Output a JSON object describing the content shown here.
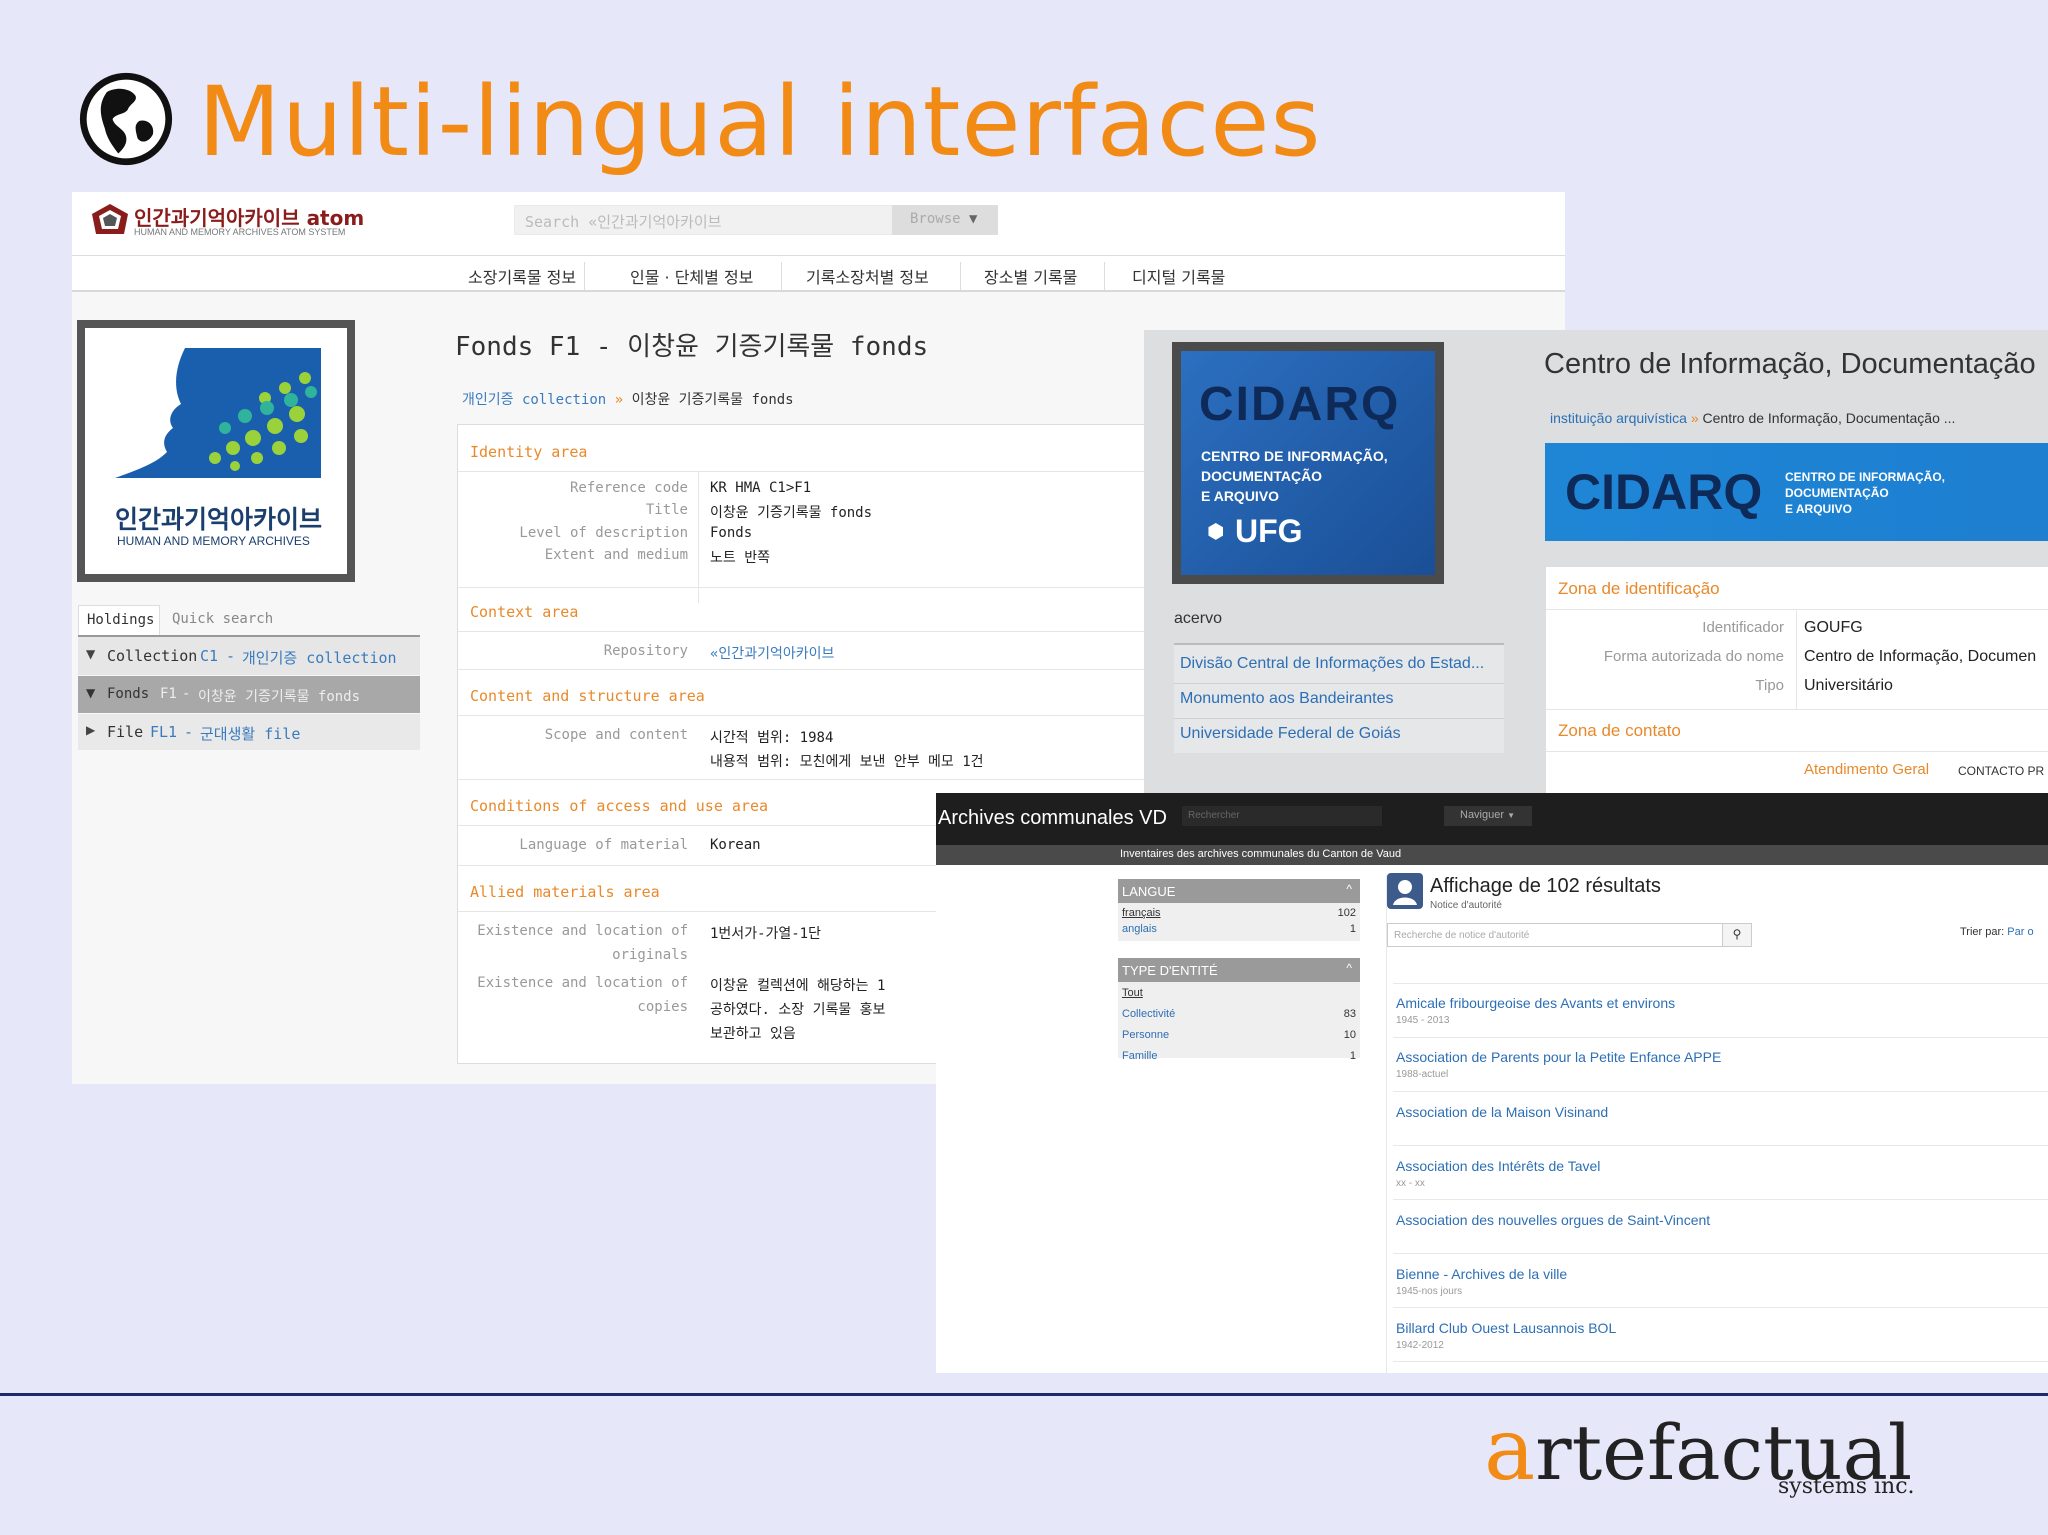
{
  "slide": {
    "title": "Multi-lingual interfaces",
    "brand_letter": "a",
    "brand_rest": "rtefactual",
    "brand_sub": "systems inc.",
    "colors": {
      "title": "#f28b16",
      "background": "#e7e7fa",
      "footer_rule": "#1a2a6a"
    }
  },
  "korean": {
    "logo_title": "인간과기억아카이브 atom",
    "logo_sub": "HUMAN AND MEMORY ARCHIVES ATOM SYSTEM",
    "search_placeholder": "Search «인간과기억아카이브",
    "browse": "Browse",
    "nav": [
      "소장기록물 정보",
      "인물 · 단체별 정보",
      "기록소장처별 정보",
      "장소별 기록물",
      "디지털 기록물"
    ],
    "repo_logo_title": "인간과기억아카이브",
    "repo_logo_sub": "HUMAN AND MEMORY ARCHIVES",
    "tabs": {
      "holdings": "Holdings",
      "quick_search": "Quick search"
    },
    "tree": [
      {
        "type": "Collection",
        "code": "C1",
        "title": "개인기증 collection"
      },
      {
        "type": "Fonds",
        "code": "F1",
        "title": "이창윤 기증기록물 fonds"
      },
      {
        "type": "File",
        "code": "FL1",
        "title": "군대생활 file"
      }
    ],
    "page_title": "Fonds F1 - 이창윤 기증기록물 fonds",
    "breadcrumb_link": "개인기증 collection",
    "breadcrumb_sep": "»",
    "breadcrumb_current": "이창윤 기증기록물 fonds",
    "sections": {
      "identity": "Identity area",
      "context": "Context area",
      "content": "Content and structure area",
      "conditions": "Conditions of access and use area",
      "allied": "Allied materials area"
    },
    "fields": {
      "ref_label": "Reference code",
      "ref_value": "KR HMA C1>F1",
      "title_label": "Title",
      "title_value": "이창윤 기증기록물 fonds",
      "level_label": "Level of description",
      "level_value": "Fonds",
      "extent_label": "Extent and medium",
      "extent_value": "노트 반쪽",
      "repo_label": "Repository",
      "repo_value": "«인간과기억아카이브",
      "scope_label": "Scope and content",
      "scope_value_1": "시간적 범위: 1984",
      "scope_value_2": "내용적 범위: 모친에게 보낸 안부 메모 1건",
      "lang_label": "Language of material",
      "lang_value": "Korean",
      "orig_label_1": "Existence and location of",
      "orig_label_2": "originals",
      "orig_value": "1번서가-가열-1단",
      "copies_label_1": "Existence and location of",
      "copies_label_2": "copies",
      "copies_value_1": "이창윤 컬렉션에 해당하는 1",
      "copies_value_2": "공하였다. 소장 기록물 홍보",
      "copies_value_3": "보관하고 있음"
    }
  },
  "cidarq": {
    "logo_big": "CIDARQ",
    "logo_line1": "CENTRO DE INFORMAÇÃO,",
    "logo_line2": "DOCUMENTAÇÃO",
    "logo_line3": "E ARQUIVO",
    "logo_ufg": "UFG",
    "acervo": "acervo",
    "links": [
      "Divisão Central de Informações do Estad...",
      "Monumento aos Bandeirantes",
      "Universidade Federal de Goiás"
    ],
    "page_title": "Centro de Informação, Documentação",
    "breadcrumb_link": "instituição arquivística",
    "breadcrumb_sep": "»",
    "breadcrumb_current": "Centro de Informação, Documentação ...",
    "banner_big": "CIDARQ",
    "banner_line1": "CENTRO DE INFORMAÇÃO,",
    "banner_line2": "DOCUMENTAÇÃO",
    "banner_line3": "E ARQUIVO",
    "zone_id": "Zona de identificação",
    "id_label": "Identificador",
    "id_value": "GOUFG",
    "name_label": "Forma autorizada do nome",
    "name_value": "Centro de Informação, Documen",
    "type_label": "Tipo",
    "type_value": "Universitário",
    "zone_contact": "Zona de contato",
    "contact_link": "Atendimento Geral",
    "contact_tag": "CONTACTO PR",
    "colors": {
      "blue": "#1c5fae",
      "accent": "#e8892a"
    }
  },
  "vaud": {
    "site_title": "Archives communales VD",
    "search_placeholder": "Rechercher",
    "browse": "Naviguer",
    "subtitle": "Inventaires des archives communales du Canton de Vaud",
    "facets": [
      {
        "title": "LANGUE",
        "items": [
          {
            "label": "français",
            "count": "102"
          },
          {
            "label": "anglais",
            "count": "1"
          }
        ]
      },
      {
        "title": "TYPE D'ENTITÉ",
        "items": [
          {
            "label": "Tout",
            "count": ""
          },
          {
            "label": "Collectivité",
            "count": "83"
          },
          {
            "label": "Personne",
            "count": "10"
          },
          {
            "label": "Famille",
            "count": "1"
          }
        ]
      }
    ],
    "results_title": "Affichage de 102 résultats",
    "results_sub": "Notice d'autorité",
    "search2_placeholder": "Recherche de notice d'autorité",
    "sort_label": "Trier par:",
    "sort_value": "Par o",
    "results": [
      {
        "name": "Amicale fribourgeoise des Avants et environs",
        "date": "1945 - 2013"
      },
      {
        "name": "Association de Parents pour la Petite Enfance APPE",
        "date": "1988-actuel"
      },
      {
        "name": "Association de la Maison Visinand",
        "date": ""
      },
      {
        "name": "Association des Intérêts de Tavel",
        "date": "xx - xx"
      },
      {
        "name": "Association des nouvelles orgues de Saint-Vincent",
        "date": ""
      },
      {
        "name": "Bienne - Archives de la ville",
        "date": "1945-nos jours"
      },
      {
        "name": "Billard Club Ouest Lausannois BOL",
        "date": "1942-2012"
      }
    ]
  }
}
